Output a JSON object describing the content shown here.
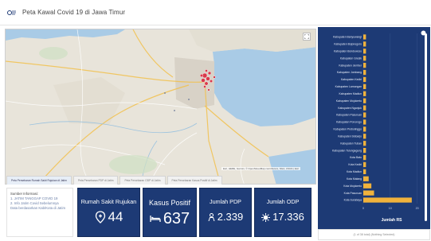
{
  "app": {
    "title": "Peta Kawal Covid 19 di Jawa Timur"
  },
  "map": {
    "layer_tabs": [
      "Peta Persebaran Rumah Sakit Rujukan di Jatim",
      "Peta Persebaran PDP di Jatim",
      "Peta Persebaran ODP di Jatim",
      "Peta Persebaran Kasus Positif di Jatim"
    ],
    "attribution": "Esri, HERE, Garmin, © OpenStreetMap contributors, NGA, USGS | Esri",
    "colors": {
      "water": "#a9cbe6",
      "land": "#e8e4da",
      "urban": "#ddd8cd",
      "hotspot": "#d9394b"
    }
  },
  "source_info": {
    "lines": [
      "Sumber Informasi:",
      "1. JATIM TANGGAP COVID 19",
      "2. Info Jatim Covid Sebelumnya",
      "Data berdasarkan Kab/Kota di Jatim"
    ]
  },
  "cards": [
    {
      "id": "rs",
      "label": "Rumah Sakit Rujukan",
      "value": "44",
      "icon": "hospital-icon"
    },
    {
      "id": "positif",
      "label": "Kasus Positif",
      "value": "637",
      "icon": "bed-icon"
    },
    {
      "id": "pdp",
      "label": "Jumlah PDP",
      "value": "2.339",
      "icon": "person-icon"
    },
    {
      "id": "odp",
      "label": "Jumlah ODP",
      "value": "17.336",
      "icon": "virus-icon"
    }
  ],
  "colors": {
    "panel": "#1d3a75",
    "bar": "#f0b23c",
    "card": "#1d3a75"
  },
  "chart_data": {
    "type": "bar",
    "orientation": "horizontal",
    "xlabel": "Jumlah RS",
    "xlim": [
      0,
      21
    ],
    "xticks": [
      0,
      10,
      20
    ],
    "categories": [
      "Kabupaten Banyuwangi",
      "Kabupaten Bojonegoro",
      "Kabupaten Bondowoso",
      "Kabupaten Gresik",
      "Kabupaten Jember",
      "Kabupaten Jombang",
      "Kabupaten Kediri",
      "Kabupaten Lamongan",
      "Kabupaten Madiun",
      "Kabupaten Mojokerto",
      "Kabupaten Nganjuk",
      "Kabupaten Pasuruan",
      "Kabupaten Ponorogo",
      "Kabupaten Probolinggo",
      "Kabupaten Sidoarjo",
      "Kabupaten Tuban",
      "Kabupaten Tulungagung",
      "Kota Batu",
      "Kota Kediri",
      "Kota Madiun",
      "Kota Malang",
      "Kota Mojokerto",
      "Kota Pasuruan",
      "Kota Surabaya"
    ],
    "values": [
      1,
      1,
      1,
      1,
      1,
      1,
      1,
      1,
      1,
      1,
      1,
      1,
      1,
      1,
      1,
      1,
      1,
      1,
      1,
      1,
      2,
      3,
      4,
      18
    ]
  },
  "panel_footer": {
    "pager": "(1 of 38 total) (Nothing Selected)"
  }
}
